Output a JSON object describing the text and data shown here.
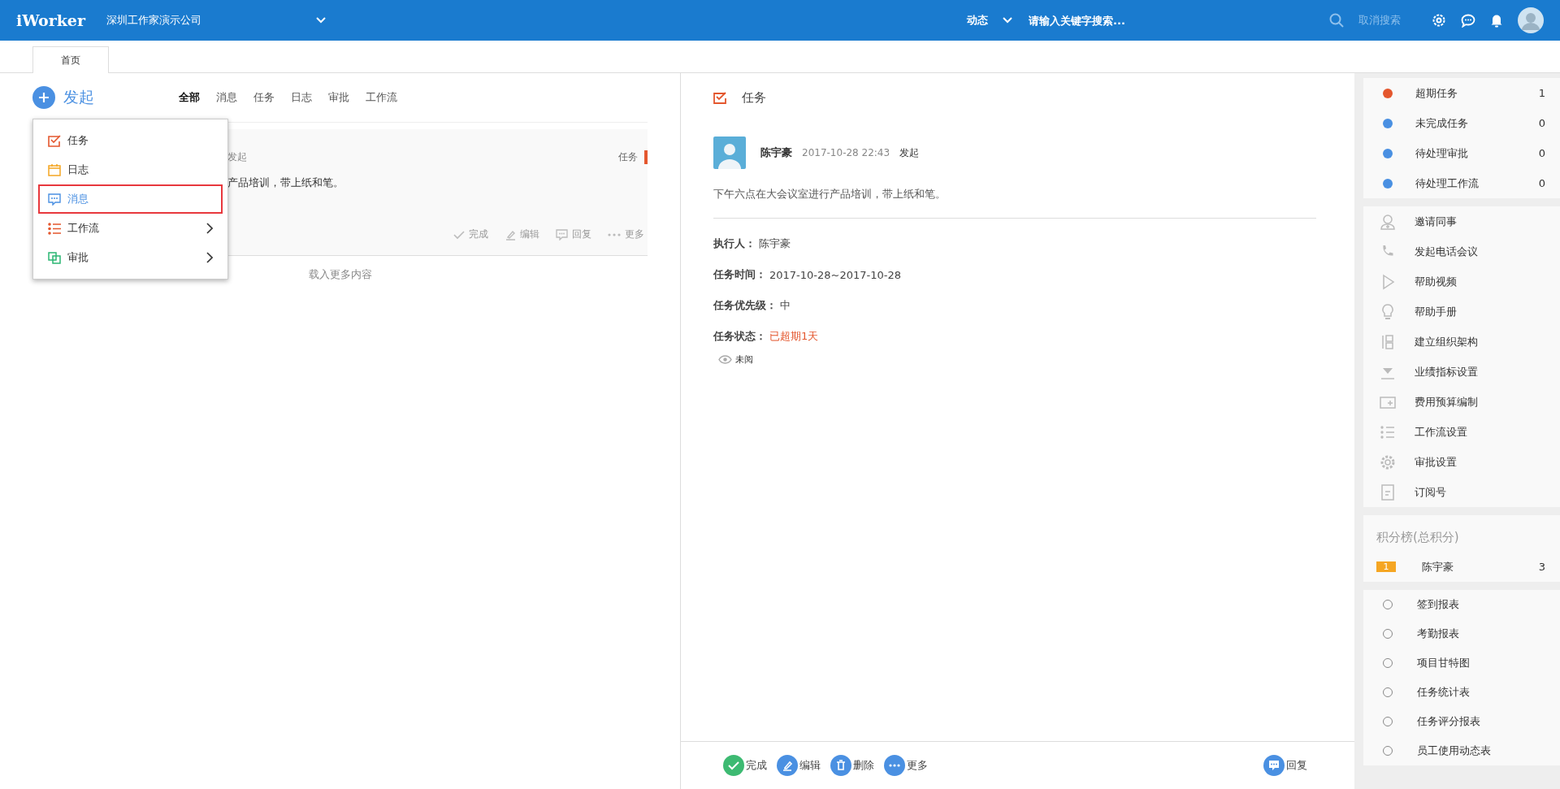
{
  "top_bar": {
    "logo": "iWorker",
    "company": "深圳工作家演示公司",
    "scope": "动态",
    "search": {
      "placeholder": "请输入关键字搜索..."
    },
    "cancel_search": "取消搜索"
  },
  "page_tabs": [
    {
      "label": "首页",
      "selected": true
    }
  ],
  "feed": {
    "new_button": "发起",
    "filters": [
      {
        "label": "全部",
        "selected": true
      },
      {
        "label": "消息",
        "selected": false
      },
      {
        "label": "任务",
        "selected": false
      },
      {
        "label": "日志",
        "selected": false
      },
      {
        "label": "审批",
        "selected": false
      },
      {
        "label": "工作流",
        "selected": false
      }
    ],
    "card": {
      "action": "发起",
      "text": "产品培训，带上纸和笔。",
      "tag": "任务",
      "buttons": [
        "完成",
        "编辑",
        "回复",
        "更多"
      ]
    },
    "load_more": "载入更多内容",
    "new_menu": [
      {
        "label": "任务",
        "selected": false,
        "has_submenu": false
      },
      {
        "label": "日志",
        "selected": false,
        "has_submenu": false
      },
      {
        "label": "消息",
        "selected": true,
        "has_submenu": false
      },
      {
        "label": "工作流",
        "selected": false,
        "has_submenu": true
      },
      {
        "label": "审批",
        "selected": false,
        "has_submenu": true
      }
    ]
  },
  "detail": {
    "title": "任务",
    "author": "陈宇豪",
    "time": "2017-10-28 22:43",
    "action": "发起",
    "description": "下午六点在大会议室进行产品培训，带上纸和笔。",
    "fields": [
      {
        "label": "执行人：",
        "value": "陈宇豪",
        "overdue": false
      },
      {
        "label": "任务时间：",
        "value": "2017-10-28~2017-10-28",
        "overdue": false
      },
      {
        "label": "任务优先级：",
        "value": "中",
        "overdue": false
      },
      {
        "label": "任务状态：",
        "value": "已超期1天",
        "overdue": true
      }
    ],
    "read_status": "未阅",
    "actions": [
      "完成",
      "编辑",
      "删除",
      "更多"
    ],
    "reply": "回复"
  },
  "sidebar": {
    "stats": [
      {
        "label": "超期任务",
        "count": "1",
        "color": "#e4572e"
      },
      {
        "label": "未完成任务",
        "count": "0",
        "color": "#4a90e2"
      },
      {
        "label": "待处理审批",
        "count": "0",
        "color": "#4a90e2"
      },
      {
        "label": "待处理工作流",
        "count": "0",
        "color": "#4a90e2"
      }
    ],
    "links": [
      "邀请同事",
      "发起电话会议",
      "帮助视频",
      "帮助手册",
      "建立组织架构",
      "业绩指标设置",
      "费用预算编制",
      "工作流设置",
      "审批设置",
      "订阅号"
    ],
    "leaderboard": {
      "title": "积分榜(总积分)",
      "rows": [
        {
          "rank": "1",
          "name": "陈宇豪",
          "score": "3"
        }
      ]
    },
    "reports": [
      "签到报表",
      "考勤报表",
      "项目甘特图",
      "任务统计表",
      "任务评分报表",
      "员工使用动态表"
    ]
  }
}
